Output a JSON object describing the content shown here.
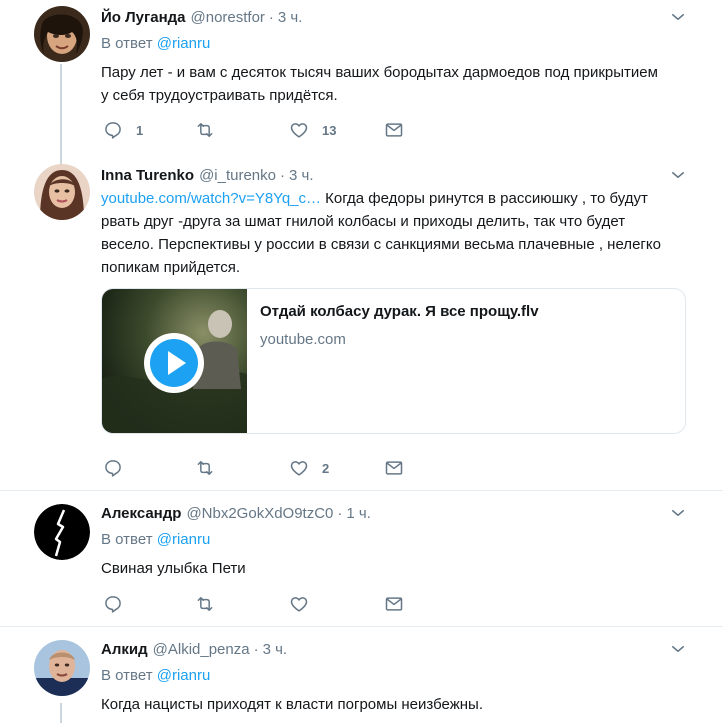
{
  "colors": {
    "accent": "#1da1f2",
    "muted": "#657786",
    "text": "#14171a",
    "border": "#e6ecf0"
  },
  "tweets": [
    {
      "name": "Йо Луганда",
      "handle": "@norestfor",
      "dot": "·",
      "time": "3 ч.",
      "reply_prefix": "В ответ",
      "reply_to": "@rianru",
      "text": "Пару лет - и вам с десяток тысяч ваших бородытах дармоедов под прикрытием у себя трудоустраивать придётся.",
      "reply_count": "1",
      "retweet_count": "",
      "like_count": "13",
      "avatar_icon": "user-avatar"
    },
    {
      "name": "Inna Turenko",
      "handle": "@i_turenko",
      "dot": "·",
      "time": "3 ч.",
      "link": "youtube.com/watch?v=Y8Yq_c…",
      "text": " Когда федоры ринутся в рассиюшку , то будут рвать друг -друга за шмат гнилой колбасы и приходы делить, так что будет весело. Перспективы у россии в связи с санкциями весьма плачевные , нелегко попикам прийдется.",
      "card": {
        "title": "Отдай колбасу дурак. Я все прощу.flv",
        "domain": "youtube.com"
      },
      "reply_count": "",
      "retweet_count": "",
      "like_count": "2",
      "avatar_icon": "user-avatar"
    },
    {
      "name": "Александр",
      "handle": "@Nbx2GokXdO9tzC0",
      "dot": "·",
      "time": "1 ч.",
      "reply_prefix": "В ответ",
      "reply_to": "@rianru",
      "text": "Свиная улыбка Пети",
      "reply_count": "",
      "retweet_count": "",
      "like_count": "",
      "avatar_icon": "user-avatar"
    },
    {
      "name": "Алкид",
      "handle": "@Alkid_penza",
      "dot": "·",
      "time": "3 ч.",
      "reply_prefix": "В ответ",
      "reply_to": "@rianru",
      "text": "Когда нацисты приходят к власти погромы неизбежны.",
      "avatar_icon": "user-avatar"
    }
  ],
  "icons": {
    "reply": "reply-icon",
    "retweet": "retweet-icon",
    "like": "heart-icon",
    "dm": "envelope-icon",
    "menu": "chevron-down-icon",
    "play": "play-icon"
  }
}
